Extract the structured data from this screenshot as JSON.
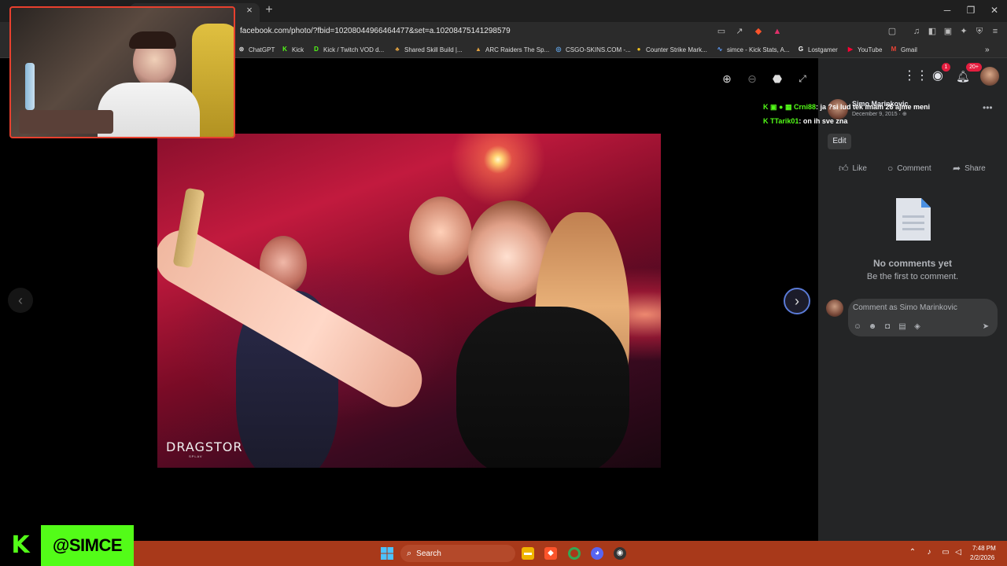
{
  "browser": {
    "url": "facebook.com/photo/?fbid=10208044966464477&set=a.10208475141298579",
    "new_tab_glyph": "+",
    "close_tab_glyph": "×",
    "bookmarks": [
      {
        "label": "ChatGPT",
        "icon": "chatgpt-icon",
        "color": "#cccccc"
      },
      {
        "label": "Kick",
        "icon": "kick-icon",
        "color": "#53fc18"
      },
      {
        "label": "Kick / Twitch VOD d...",
        "icon": "kick-d-icon",
        "color": "#53fc18"
      },
      {
        "label": "Shared Skill Build |...",
        "icon": "leaf-icon",
        "color": "#e0a040"
      },
      {
        "label": "ARC Raiders The Sp...",
        "icon": "arc-icon",
        "color": "#e0a040"
      },
      {
        "label": "CSGO-SKINS.COM -...",
        "icon": "csgo-icon",
        "color": "#60a0e0"
      },
      {
        "label": "Counter Strike Mark...",
        "icon": "cs-market-icon",
        "color": "#f0c020"
      },
      {
        "label": "simce - Kick Stats, A...",
        "icon": "stats-icon",
        "color": "#60a0ff"
      },
      {
        "label": "Lostgamer",
        "icon": "lostgamer-icon",
        "color": "#ffffff"
      },
      {
        "label": "YouTube",
        "icon": "youtube-icon",
        "color": "#ff0033"
      },
      {
        "label": "Gmail",
        "icon": "gmail-icon",
        "color": "#ea4335"
      }
    ]
  },
  "viewer": {
    "photo_watermark": "DRAGSTOR",
    "photo_watermark_sub": "SPLAV"
  },
  "chat": [
    {
      "user": "Crni88",
      "message": ": ja ?si lud tek imam 26 ajme meni",
      "user_color": "#53fc18"
    },
    {
      "user": "TTarik01",
      "message": ": on ih sve zna",
      "user_color": "#53fc18"
    }
  ],
  "sidebar": {
    "notif_badge_messenger": "1",
    "notif_badge_bell": "20+",
    "post_author": "Simo Marinkovic",
    "post_date": "December 9, 2015 · ",
    "edit_label": "Edit",
    "actions": {
      "like": "Like",
      "comment": "Comment",
      "share": "Share"
    },
    "no_comments_title": "No comments yet",
    "no_comments_sub": "Be the first to comment.",
    "comment_placeholder": "Comment as Simo Marinkovic"
  },
  "stream": {
    "handle": "@SIMCE",
    "platform_logo": "K"
  },
  "taskbar": {
    "search_label": "Search",
    "time": "7:48 PM",
    "date": "2/2/2026",
    "discord_badge": "●"
  },
  "colors": {
    "facebook_dark": "#242526",
    "kick_green": "#53fc18",
    "taskbar": "#a8391a"
  }
}
